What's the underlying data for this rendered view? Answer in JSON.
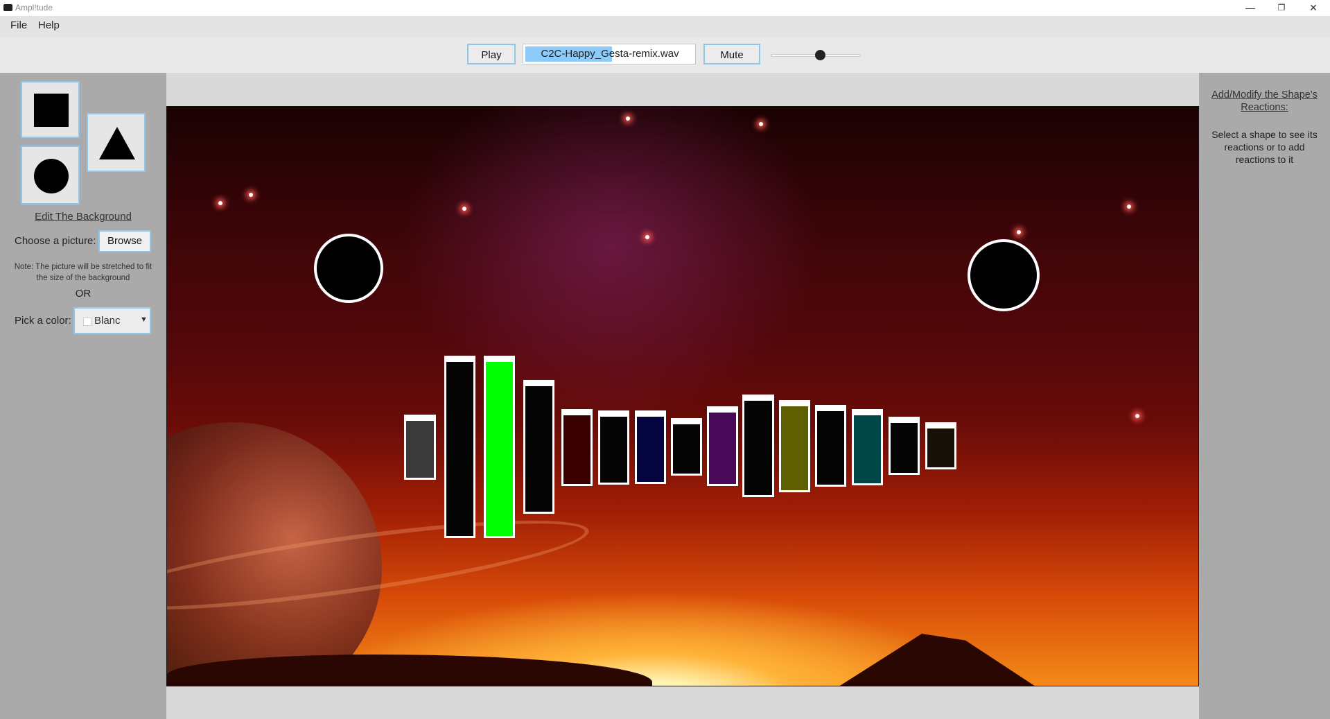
{
  "window": {
    "title": "Ampl!tude",
    "minimize": "—",
    "restore": "❐",
    "close": "✕"
  },
  "menu": {
    "file": "File",
    "help": "Help"
  },
  "toolbar": {
    "play_label": "Play",
    "file_name": "C2C-Happy_Gesta-remix.wav",
    "mute_label": "Mute",
    "volume": 0.55
  },
  "left_panel": {
    "shapes": [
      "square",
      "triangle",
      "circle"
    ],
    "edit_background": "Edit The Background",
    "choose_picture": "Choose a picture:",
    "browse": "Browse",
    "note": "Note: The picture will be stretched to fit the size of the background",
    "or": "OR",
    "pick_color": "Pick a color:",
    "color_value": "Blanc",
    "color_swatch": "#ffffff"
  },
  "right_panel": {
    "title": "Add/Modify the Shape's Reactions:",
    "hint": "Select a shape to see its reactions or to add reactions to it"
  },
  "scene": {
    "bar_colors": [
      "#3a3a3a",
      "#050505",
      "#00ff00",
      "#050505",
      "#3a0000",
      "#050505",
      "#050540",
      "#050505",
      "#4a0a5a",
      "#050505",
      "#5e6000",
      "#050505",
      "#004848",
      "#050505",
      "#161008"
    ]
  }
}
